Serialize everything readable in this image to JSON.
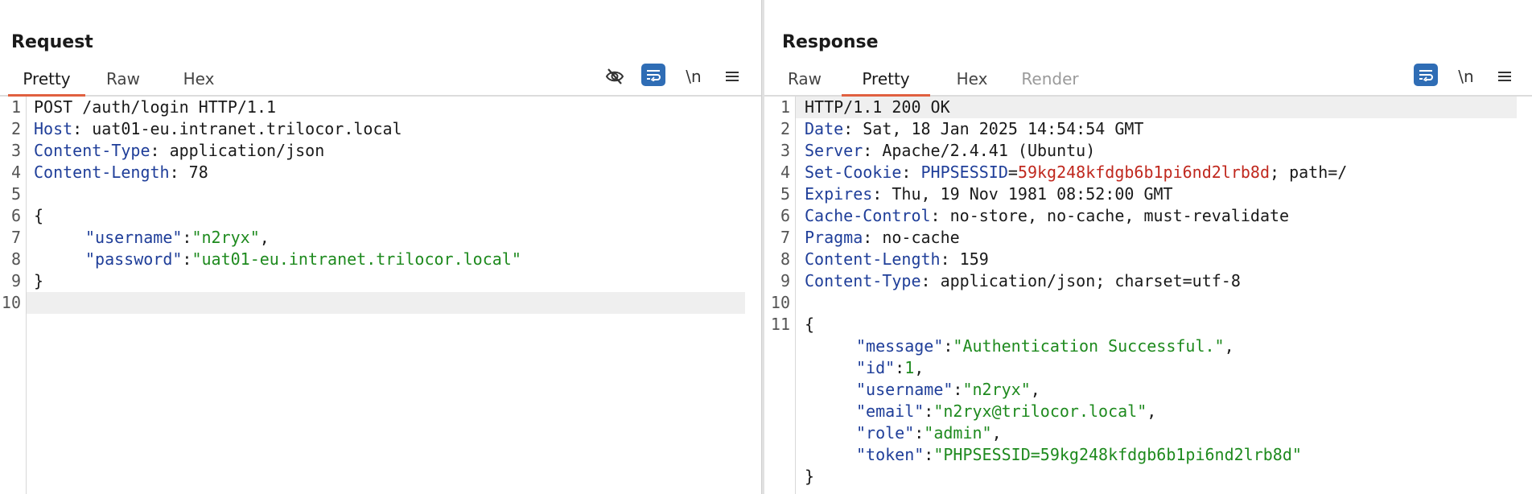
{
  "request": {
    "title": "Request",
    "tabs": [
      {
        "label": "Pretty",
        "active": true
      },
      {
        "label": "Raw",
        "active": false
      },
      {
        "label": "Hex",
        "active": false
      }
    ],
    "toolbar": {
      "newline_label": "\\n"
    },
    "line_numbers": [
      "1",
      "2",
      "3",
      "4",
      "5",
      "6",
      "7",
      "8",
      "9",
      "10"
    ],
    "lines": {
      "l1": "POST /auth/login HTTP/1.1",
      "l2_key": "Host",
      "l2_sep": ": ",
      "l2_val": "uat01-eu.intranet.trilocor.local",
      "l3_key": "Content-Type",
      "l3_sep": ": ",
      "l3_val": "application/json",
      "l4_key": "Content-Length",
      "l4_sep": ": ",
      "l4_val": "78",
      "l6": "{",
      "l7_key": "\"username\"",
      "l7_sep": ":",
      "l7_val": "\"n2ryx\"",
      "l7_end": ",",
      "l8_key": "\"password\"",
      "l8_sep": ":",
      "l8_val": "\"uat01-eu.intranet.trilocor.local\"",
      "l9": "}"
    }
  },
  "response": {
    "title": "Response",
    "tabs": [
      {
        "label": "Raw",
        "active": false
      },
      {
        "label": "Pretty",
        "active": true
      },
      {
        "label": "Hex",
        "active": false
      },
      {
        "label": "Render",
        "active": false,
        "disabled": true
      }
    ],
    "toolbar": {
      "newline_label": "\\n"
    },
    "line_numbers": [
      "1",
      "2",
      "3",
      "4",
      "5",
      "6",
      "7",
      "8",
      "9",
      "10",
      "11"
    ],
    "lines": {
      "l1": "HTTP/1.1 200 OK",
      "l2_key": "Date",
      "l2_sep": ": ",
      "l2_val": "Sat, 18 Jan 2025 14:54:54 GMT",
      "l3_key": "Server",
      "l3_sep": ": ",
      "l3_val": "Apache/2.4.41 (Ubuntu)",
      "l4_key": "Set-Cookie",
      "l4_sep": ": ",
      "l4_ckey": "PHPSESSID",
      "l4_eq": "=",
      "l4_cval": "59kg248kfdgb6b1pi6nd2lrb8d",
      "l4_rest": "; path=/",
      "l5_key": "Expires",
      "l5_sep": ": ",
      "l5_val": "Thu, 19 Nov 1981 08:52:00 GMT",
      "l6_key": "Cache-Control",
      "l6_sep": ": ",
      "l6_val": "no-store, no-cache, must-revalidate",
      "l7_key": "Pragma",
      "l7_sep": ": ",
      "l7_val": "no-cache",
      "l8_key": "Content-Length",
      "l8_sep": ": ",
      "l8_val": "159",
      "l9_key": "Content-Type",
      "l9_sep": ": ",
      "l9_val": "application/json; charset=utf-8",
      "l11": "{",
      "j1_key": "\"message\"",
      "j1_sep": ":",
      "j1_val": "\"Authentication Successful.\"",
      "j1_end": ",",
      "j2_key": "\"id\"",
      "j2_sep": ":",
      "j2_val": "1",
      "j2_end": ",",
      "j3_key": "\"username\"",
      "j3_sep": ":",
      "j3_val": "\"n2ryx\"",
      "j3_end": ",",
      "j4_key": "\"email\"",
      "j4_sep": ":",
      "j4_val": "\"n2ryx@trilocor.local\"",
      "j4_end": ",",
      "j5_key": "\"role\"",
      "j5_sep": ":",
      "j5_val": "\"admin\"",
      "j5_end": ",",
      "j6_key": "\"token\"",
      "j6_sep": ":",
      "j6_val": "\"PHPSESSID=59kg248kfdgb6b1pi6nd2lrb8d\"",
      "close": "}"
    }
  },
  "colors": {
    "accent": "#2f6db5",
    "tab_underline": "#e06040",
    "header_key": "#1f3e99",
    "json_string": "#1e8a1e",
    "cookie_value": "#c0281e"
  },
  "icons": {
    "request_toolbar": [
      "eye-off-icon",
      "wrap-icon",
      "newline-toggle",
      "menu-icon"
    ],
    "response_toolbar": [
      "wrap-icon",
      "newline-toggle",
      "menu-icon"
    ],
    "view_toggle": [
      "split-horizontal-icon",
      "split-vertical-icon",
      "single-pane-icon"
    ]
  }
}
